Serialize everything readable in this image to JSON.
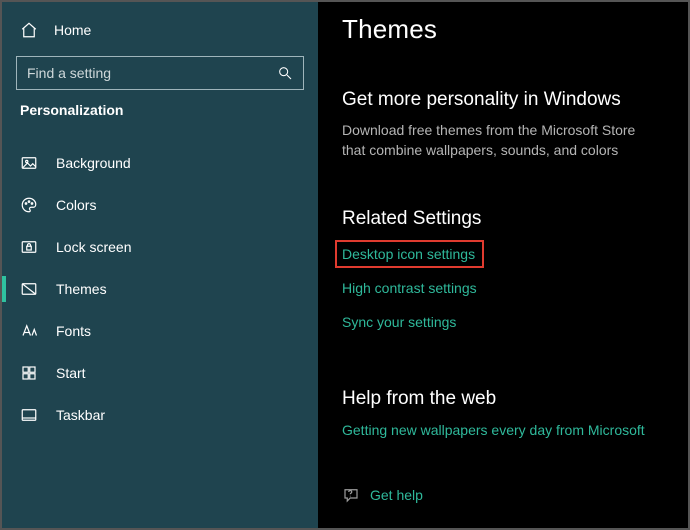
{
  "sidebar": {
    "home": "Home",
    "search_placeholder": "Find a setting",
    "section": "Personalization",
    "items": [
      {
        "label": "Background"
      },
      {
        "label": "Colors"
      },
      {
        "label": "Lock screen"
      },
      {
        "label": "Themes"
      },
      {
        "label": "Fonts"
      },
      {
        "label": "Start"
      },
      {
        "label": "Taskbar"
      }
    ]
  },
  "main": {
    "title": "Themes",
    "more_heading": "Get more personality in Windows",
    "more_text": "Download free themes from the Microsoft Store that combine wallpapers, sounds, and colors",
    "related_heading": "Related Settings",
    "links": [
      "Desktop icon settings",
      "High contrast settings",
      "Sync your settings"
    ],
    "help_heading": "Help from the web",
    "help_link": "Getting new wallpapers every day from Microsoft",
    "get_help": "Get help"
  }
}
